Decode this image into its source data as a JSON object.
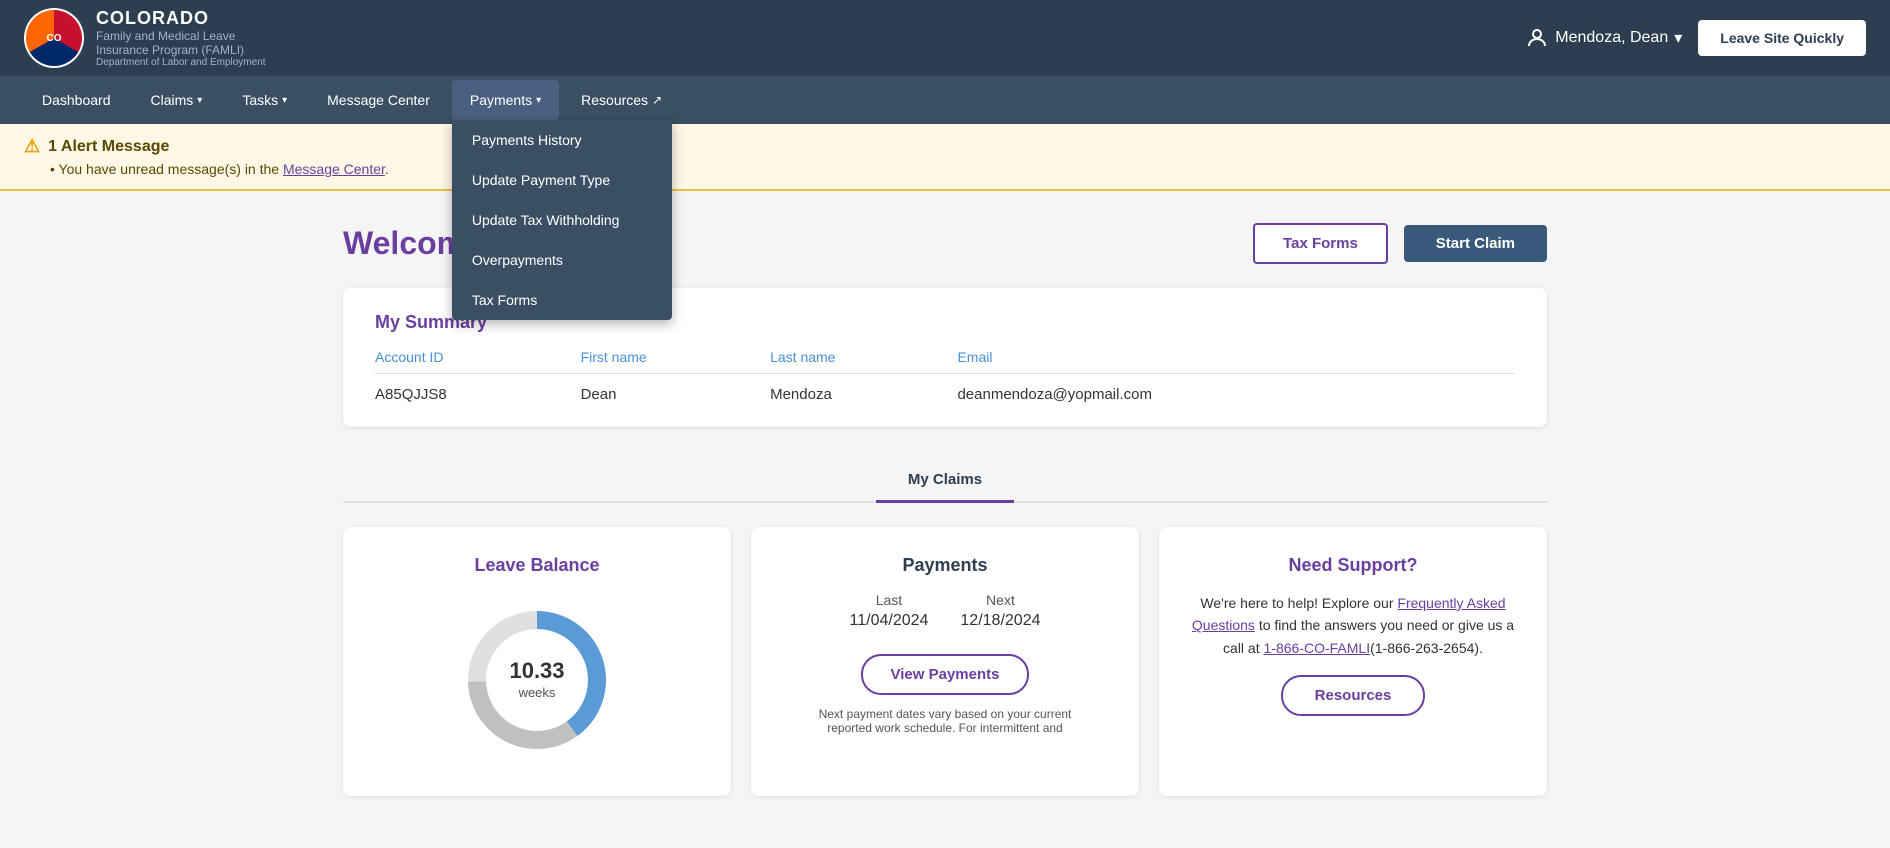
{
  "header": {
    "logo_title": "COLORADO",
    "logo_subtitle": "Family and Medical Leave",
    "logo_subtitle2": "Insurance Program (FAMLI)",
    "logo_dept": "Department of Labor and Employment",
    "user_name": "Mendoza, Dean",
    "leave_site_btn": "Leave Site Quickly"
  },
  "nav": {
    "items": [
      {
        "label": "Dashboard",
        "has_caret": false
      },
      {
        "label": "Claims",
        "has_caret": true
      },
      {
        "label": "Tasks",
        "has_caret": true
      },
      {
        "label": "Message Center",
        "has_caret": false
      },
      {
        "label": "Payments",
        "has_caret": true,
        "active": true
      },
      {
        "label": "Resources",
        "has_caret": false,
        "external": true
      }
    ],
    "payments_dropdown": [
      {
        "label": "Payments History"
      },
      {
        "label": "Update Payment Type"
      },
      {
        "label": "Update Tax Withholding"
      },
      {
        "label": "Overpayments"
      },
      {
        "label": "Tax Forms"
      }
    ]
  },
  "alert": {
    "count": "1",
    "title": "1 Alert Message",
    "message": "You have unread message(s) in the ",
    "link_text": "Message Center",
    "link_suffix": "."
  },
  "main": {
    "welcome": "Welcome, Dean!",
    "tax_forms_btn": "Tax Forms",
    "start_claim_btn": "Start Claim",
    "summary": {
      "title": "My Summary",
      "columns": [
        "Account ID",
        "First name",
        "Last name",
        "Email"
      ],
      "row": {
        "account_id": "A85QJJS8",
        "first_name": "Dean",
        "last_name": "Mendoza",
        "email": "deanmendoza@yopmail.com"
      }
    },
    "tabs": [
      {
        "label": "My Claims",
        "active": true
      }
    ],
    "cards": {
      "leave_balance": {
        "title": "Leave Balance",
        "value": "10.33",
        "unit": "weeks",
        "donut_used": 65,
        "donut_remaining": 35
      },
      "payments": {
        "title": "Payments",
        "last_label": "Last",
        "next_label": "Next",
        "last_date": "11/04/2024",
        "next_date": "12/18/2024",
        "view_btn": "View Payments",
        "note": "Next payment dates vary based on your current reported work schedule. For intermittent and"
      },
      "support": {
        "title": "Need Support?",
        "text1": "We're here to help! Explore our ",
        "faq_link": "Frequently Asked Questions",
        "text2": " to find the answers you need or give us a call at ",
        "phone_link": "1-866-CO-FAMLI",
        "phone_number": "(1-866-263-2654).",
        "resources_btn": "Resources"
      }
    }
  }
}
